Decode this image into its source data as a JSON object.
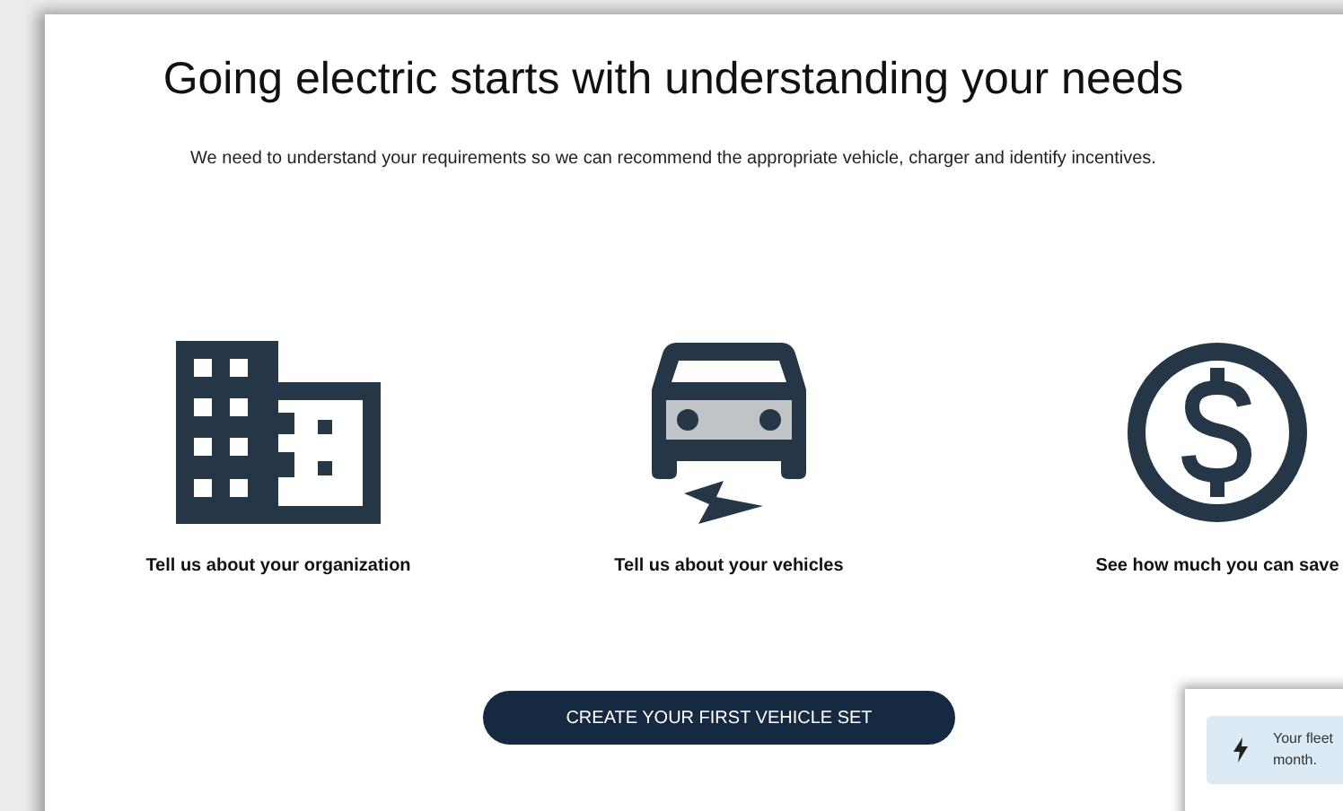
{
  "heading": "Going electric starts with understanding your needs",
  "intro": "We need to understand your requirements so we can recommend the appropriate vehicle, charger and identify incentives.",
  "steps": [
    {
      "kind": "organization",
      "label": "Tell us about your organization"
    },
    {
      "kind": "vehicles",
      "label": "Tell us about your vehicles"
    },
    {
      "kind": "savings",
      "label": "See how much you can save"
    }
  ],
  "button": "CREATE YOUR FIRST VEHICLE SET",
  "notice": {
    "lines": [
      "Your fleet",
      "month."
    ]
  }
}
